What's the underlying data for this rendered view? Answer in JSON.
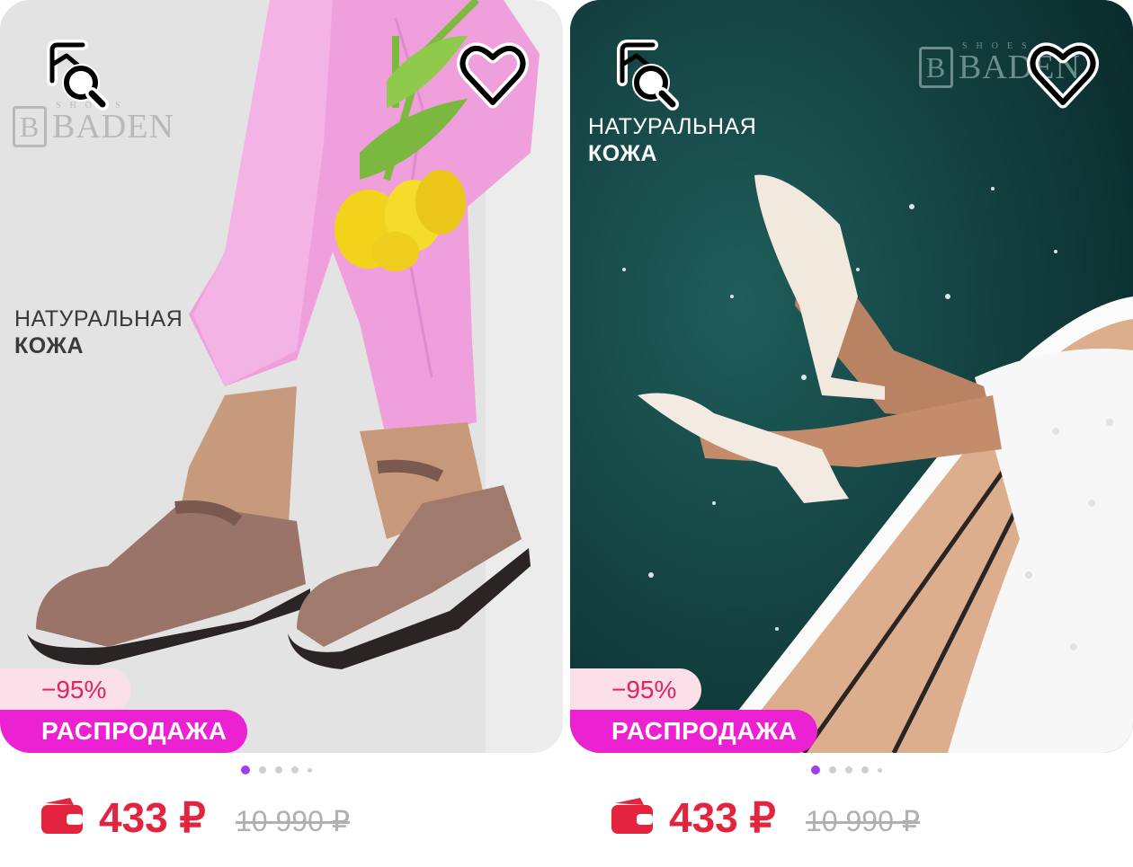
{
  "products": [
    {
      "brand": "BADEN",
      "brand_sub": "SHOES",
      "claim_line1": "НАТУРАЛЬНАЯ",
      "claim_line2": "КОЖА",
      "discount": "−95%",
      "badge": "РАСПРОДАЖА",
      "price": "433 ₽",
      "old_price": "10 990 ₽",
      "photo_index": 1,
      "photo_count": 5
    },
    {
      "brand": "BADEN",
      "brand_sub": "SHOES",
      "claim_line1": "НАТУРАЛЬНАЯ",
      "claim_line2": "КОЖА",
      "discount": "−95%",
      "badge": "РАСПРОДАЖА",
      "price": "433 ₽",
      "old_price": "10 990 ₽",
      "photo_index": 1,
      "photo_count": 5
    }
  ],
  "icons": {
    "similar_search": "image-search-icon",
    "favorite": "heart-outline-icon",
    "price_badge": "wallet-icon"
  },
  "colors": {
    "price": "#e3243f",
    "discount_bg": "#fbe0ea",
    "discount_text": "#e0245e",
    "sale_badge": "#ec22d2",
    "dot_active": "#9b3ff0"
  }
}
